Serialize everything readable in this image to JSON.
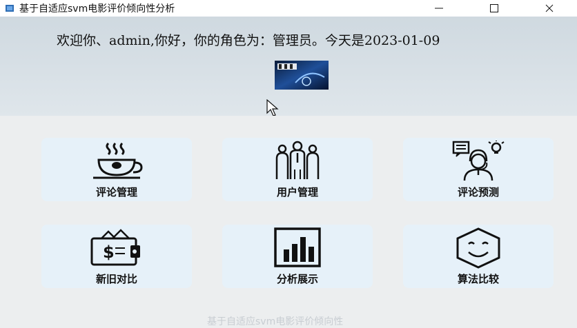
{
  "window": {
    "title": "基于自适应svm电影评价倾向性分析"
  },
  "header": {
    "welcome_text": "欢迎你、admin,你好，你的角色为：管理员。今天是2023-01-09"
  },
  "cards": [
    {
      "label": "评论管理",
      "icon": "coffee-cup-icon"
    },
    {
      "label": "用户管理",
      "icon": "users-group-icon"
    },
    {
      "label": "评论预测",
      "icon": "support-agent-icon"
    },
    {
      "label": "新旧对比",
      "icon": "wallet-icon"
    },
    {
      "label": "分析展示",
      "icon": "bar-chart-icon"
    },
    {
      "label": "算法比较",
      "icon": "smiley-hexagon-icon"
    }
  ],
  "footer": {
    "text": "基于自适应svm电影评价倾向性"
  }
}
